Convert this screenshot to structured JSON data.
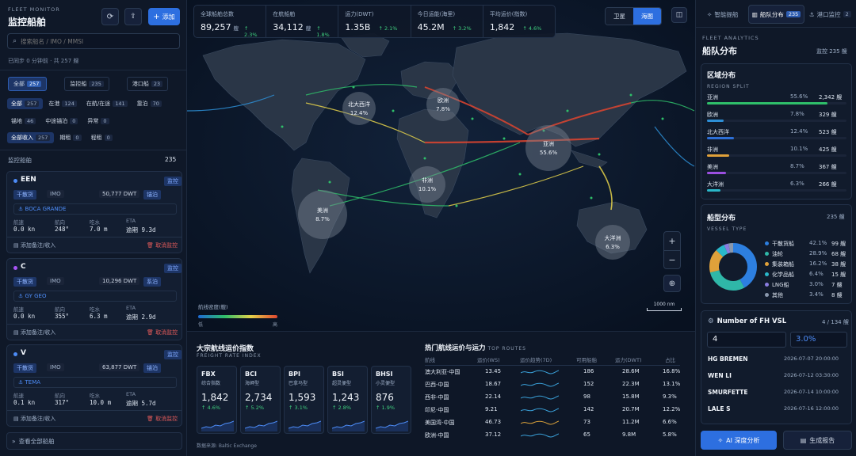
{
  "header": {
    "kicker": "FLEET MONITOR",
    "title": "监控船舶",
    "add_label": "添加"
  },
  "search": {
    "placeholder": "搜索船名 / IMO / MMSI"
  },
  "sync": {
    "text": "已同步 0 分钟前 · 共 257 艘"
  },
  "tabs": [
    {
      "label": "全部",
      "count": "257"
    },
    {
      "label": "监控船",
      "count": "235"
    },
    {
      "label": "港口船",
      "count": "23"
    }
  ],
  "filters_row1": [
    {
      "label": "全部",
      "count": "257"
    },
    {
      "label": "在港",
      "count": "124"
    },
    {
      "label": "在航/在途",
      "count": "141"
    },
    {
      "label": "靠泊",
      "count": "70"
    }
  ],
  "filters_row2": [
    {
      "label": "锚地",
      "count": "46"
    },
    {
      "label": "中途锚泊",
      "count": "0"
    },
    {
      "label": "异常",
      "count": "0"
    }
  ],
  "filters_row3": [
    {
      "label": "全部收入",
      "count": "257"
    },
    {
      "label": "期租",
      "count": "0"
    },
    {
      "label": "程租",
      "count": "0"
    }
  ],
  "watch": {
    "label": "监控船舶",
    "count": "235"
  },
  "vessels": [
    {
      "name": "EEN",
      "badge": "监控",
      "type": "干散货",
      "imo": "IMO",
      "dwt": "50,777 DWT",
      "status": "锚泊",
      "dest": "BOCA GRANDE",
      "speed_l": "航速",
      "speed": "0.0 kn",
      "hd_l": "航向",
      "hd": "248°",
      "draft_l": "吃水",
      "draft": "7.0 m",
      "eta_l": "ETA",
      "eta": "逾期 9.3d",
      "note": "添加备注/收入",
      "unwatch": "取消监控",
      "dot": "#4d8cf7",
      "status_color": "#4d8cf7"
    },
    {
      "name": "C",
      "badge": "监控",
      "type": "干散货",
      "imo": "IMO",
      "dwt": "10,296 DWT",
      "status": "系泊",
      "dest": "GY GEO",
      "speed_l": "航速",
      "speed": "0.0 kn",
      "hd_l": "航向",
      "hd": "355°",
      "draft_l": "吃水",
      "draft": "6.3 m",
      "eta_l": "ETA",
      "eta": "逾期 2.9d",
      "note": "添加备注/收入",
      "unwatch": "取消监控",
      "dot": "#a855f7",
      "status_color": "#4d8cf7"
    },
    {
      "name": "V",
      "badge": "监控",
      "type": "干散货",
      "imo": "IMO",
      "dwt": "63,877 DWT",
      "status": "锚泊",
      "dest": "TEMA",
      "speed_l": "航速",
      "speed": "0.1 kn",
      "hd_l": "航向",
      "hd": "317°",
      "draft_l": "吃水",
      "draft": "10.0 m",
      "eta_l": "ETA",
      "eta": "逾期 5.7d",
      "note": "添加备注/收入",
      "unwatch": "取消监控",
      "dot": "#4d8cf7",
      "status_color": "#4d8cf7"
    }
  ],
  "view_all": "查看全部船舶",
  "stats": [
    {
      "label": "全球船舶总数",
      "value": "89,257",
      "unit": "艘",
      "delta": "↑ 2.3%"
    },
    {
      "label": "在航船舶",
      "value": "34,112",
      "unit": "艘",
      "delta": "↑ 1.8%"
    },
    {
      "label": "运力(DWT)",
      "value": "1.35B",
      "unit": "",
      "delta": "↑ 2.1%"
    },
    {
      "label": "今日运能(海里)",
      "value": "45.2M",
      "unit": "",
      "delta": "↑ 3.2%"
    },
    {
      "label": "平均运价(指数)",
      "value": "1,842",
      "unit": "",
      "delta": "↑ 4.6%"
    }
  ],
  "map_toggle": {
    "satellite": "卫星",
    "sea": "海图"
  },
  "regions_map": [
    {
      "name": "北大西洋",
      "pct": "12.4%"
    },
    {
      "name": "欧洲",
      "pct": "7.8%"
    },
    {
      "name": "亚洲",
      "pct": "55.6%"
    },
    {
      "name": "非洲",
      "pct": "10.1%"
    },
    {
      "name": "美洲",
      "pct": "8.7%"
    },
    {
      "name": "大洋洲",
      "pct": "6.3%"
    }
  ],
  "legend": {
    "title": "航线密度(艘)",
    "low": "低",
    "high": "高"
  },
  "scale": "1000 nm",
  "freight": {
    "title": "大宗航线运价指数",
    "subtitle": "FREIGHT RATE INDEX",
    "source": "数据来源: Baltic Exchange",
    "items": [
      {
        "code": "FBX",
        "name": "综合指数",
        "value": "1,842",
        "delta": "↑ 4.6%"
      },
      {
        "code": "BCI",
        "name": "海岬型",
        "value": "2,734",
        "delta": "↑ 5.2%"
      },
      {
        "code": "BPI",
        "name": "巴拿马型",
        "value": "1,593",
        "delta": "↑ 3.1%"
      },
      {
        "code": "BSI",
        "name": "超灵便型",
        "value": "1,243",
        "delta": "↑ 2.8%"
      },
      {
        "code": "BHSI",
        "name": "小灵便型",
        "value": "876",
        "delta": "↑ 1.9%"
      }
    ]
  },
  "routes": {
    "title": "热门航线运价与运力",
    "subtitle": "TOP ROUTES",
    "headers": [
      "航线",
      "运价(WS)",
      "运价趋势(7D)",
      "可用船舶",
      "运力(DWT)",
      "占比"
    ],
    "rows": [
      {
        "route": "澳大利亚-中国",
        "ws": "13.45",
        "ships": "186",
        "dwt": "28.6M",
        "pct": "16.8%",
        "color": "#3aa0d8"
      },
      {
        "route": "巴西-中国",
        "ws": "18.67",
        "ships": "152",
        "dwt": "22.3M",
        "pct": "13.1%",
        "color": "#3aa0d8"
      },
      {
        "route": "西非-中国",
        "ws": "22.14",
        "ships": "98",
        "dwt": "15.8M",
        "pct": "9.3%",
        "color": "#3aa0d8"
      },
      {
        "route": "印尼-中国",
        "ws": "9.21",
        "ships": "142",
        "dwt": "20.7M",
        "pct": "12.2%",
        "color": "#3aa0d8"
      },
      {
        "route": "美国湾-中国",
        "ws": "46.73",
        "ships": "73",
        "dwt": "11.2M",
        "pct": "6.6%",
        "color": "#d8a03a"
      },
      {
        "route": "欧洲-中国",
        "ws": "37.12",
        "ships": "65",
        "dwt": "9.8M",
        "pct": "5.8%",
        "color": "#3aa0d8"
      }
    ]
  },
  "right_tabs": [
    {
      "label": "智能提船",
      "count": ""
    },
    {
      "label": "船队分布",
      "count": "235"
    },
    {
      "label": "港口监控",
      "count": "2"
    }
  ],
  "analytics": {
    "kicker": "FLEET ANALYTICS",
    "title": "船队分布",
    "watch": "监控 235 艘"
  },
  "region_split": {
    "title": "区域分布",
    "kicker": "REGION SPLIT",
    "rows": [
      {
        "name": "亚洲",
        "pct": "55.6%",
        "count": "2,342 艘",
        "frac": 0.556,
        "color": "#2fbf6a"
      },
      {
        "name": "欧洲",
        "pct": "7.8%",
        "count": "329 艘",
        "frac": 0.078,
        "color": "#2d8fd6"
      },
      {
        "name": "北大西洋",
        "pct": "12.4%",
        "count": "523 艘",
        "frac": 0.124,
        "color": "#2d6fd6"
      },
      {
        "name": "非洲",
        "pct": "10.1%",
        "count": "425 艘",
        "frac": 0.101,
        "color": "#e0a13a"
      },
      {
        "name": "美洲",
        "pct": "8.7%",
        "count": "367 艘",
        "frac": 0.087,
        "color": "#9b4fe0"
      },
      {
        "name": "大洋洲",
        "pct": "6.3%",
        "count": "266 艘",
        "frac": 0.063,
        "color": "#2ab7c9"
      }
    ]
  },
  "vessel_type": {
    "title": "船型分布",
    "count": "235 艘",
    "kicker": "VESSEL TYPE",
    "rows": [
      {
        "name": "干散货船",
        "pct": "42.1%",
        "count": "99 艘",
        "frac": 0.421,
        "color": "#2d7fe0"
      },
      {
        "name": "油轮",
        "pct": "28.9%",
        "count": "68 艘",
        "frac": 0.289,
        "color": "#2fb7a8"
      },
      {
        "name": "集装箱船",
        "pct": "16.2%",
        "count": "38 艘",
        "frac": 0.162,
        "color": "#e0a13a"
      },
      {
        "name": "化学品船",
        "pct": "6.4%",
        "count": "15 艘",
        "frac": 0.064,
        "color": "#2ab7c9"
      },
      {
        "name": "LNG船",
        "pct": "3.0%",
        "count": "7 艘",
        "frac": 0.03,
        "color": "#8a7de0"
      },
      {
        "name": "其他",
        "pct": "3.4%",
        "count": "8 艘",
        "frac": 0.034,
        "color": "#8a98ad"
      }
    ]
  },
  "fh": {
    "title": "Number of FH VSL",
    "count": "4 / 134 艘",
    "input_value": "4",
    "pct_value": "3.0%",
    "rows": [
      {
        "name": "HG BREMEN",
        "time": "2026-07-07 20:00:00"
      },
      {
        "name": "WEN LI",
        "time": "2026-07-12 03:30:00"
      },
      {
        "name": "SMURFETTE",
        "time": "2026-07-14 10:00:00"
      },
      {
        "name": "LALE S",
        "time": "2026-07-16 12:00:00"
      }
    ]
  },
  "actions": {
    "ai": "AI 深度分析",
    "report": "生成报告"
  }
}
